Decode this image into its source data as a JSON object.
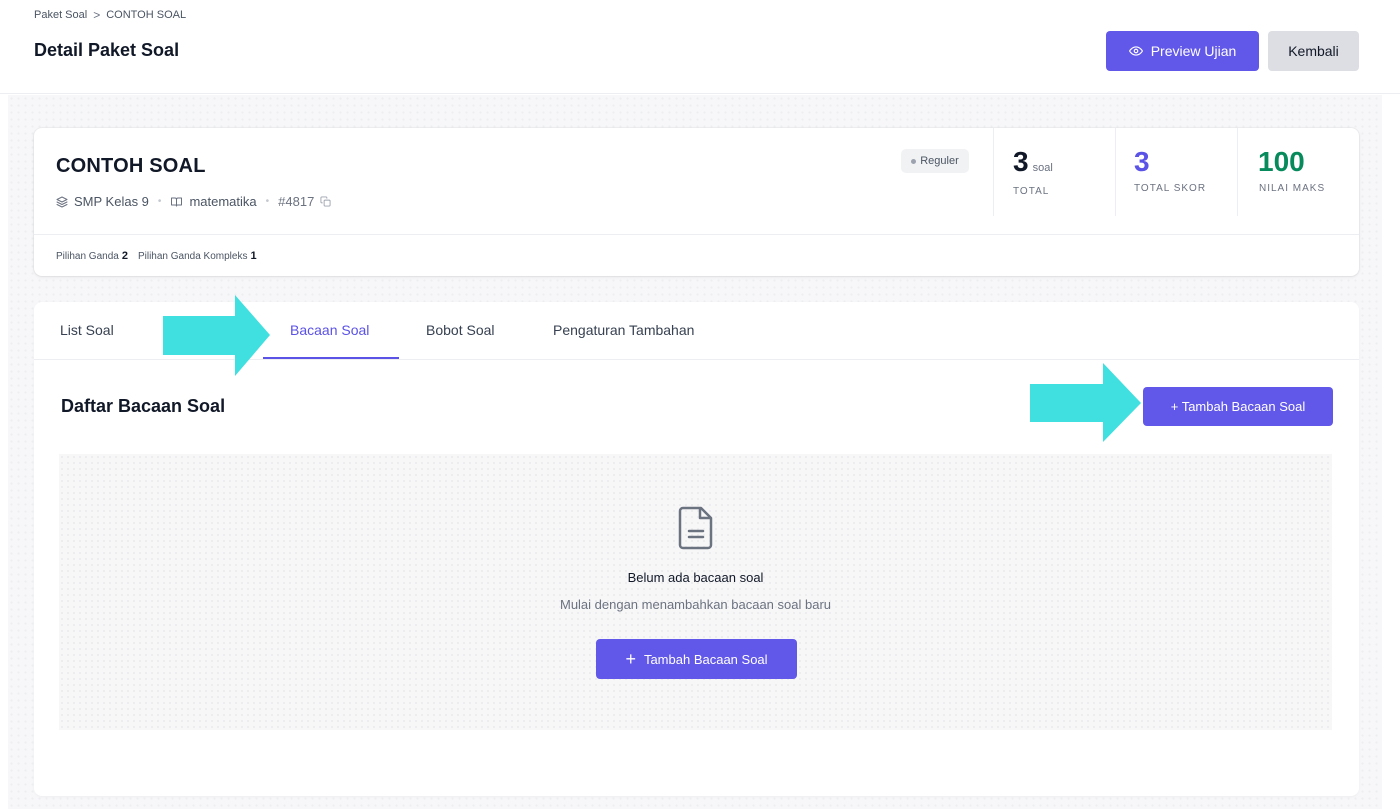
{
  "breadcrumb": {
    "root": "Paket Soal",
    "separator": ">",
    "current": "CONTOH SOAL"
  },
  "header": {
    "title": "Detail Paket Soal",
    "preview_label": "Preview Ujian",
    "back_label": "Kembali"
  },
  "summary": {
    "name": "CONTOH SOAL",
    "level": "SMP Kelas 9",
    "subject": "matematika",
    "id": "#4817",
    "badge": "Reguler",
    "stats": [
      {
        "value": "3",
        "unit": "soal",
        "label": "TOTAL",
        "color": "#111827"
      },
      {
        "value": "3",
        "unit": "",
        "label": "TOTAL SKOR",
        "color": "#5b52e6"
      },
      {
        "value": "100",
        "unit": "",
        "label": "NILAI MAKS",
        "color": "#078a5c"
      }
    ],
    "question_types": [
      {
        "label": "Pilihan Ganda",
        "count": "2"
      },
      {
        "label": "Pilihan Ganda Kompleks",
        "count": "1"
      }
    ]
  },
  "tabs": [
    {
      "label": "List Soal",
      "active": false
    },
    {
      "label": "Bacaan Soal",
      "active": true
    },
    {
      "label": "Bobot Soal",
      "active": false
    },
    {
      "label": "Pengaturan Tambahan",
      "active": false
    }
  ],
  "section": {
    "title": "Daftar Bacaan Soal",
    "add_button": "+ Tambah Bacaan Soal",
    "empty_title": "Belum ada bacaan soal",
    "empty_desc": "Mulai dengan menambahkan bacaan soal baru",
    "empty_add_button": "Tambah Bacaan Soal"
  },
  "colors": {
    "primary": "#6157e8",
    "annotation_arrow": "#40dfe0",
    "success": "#078a5c"
  }
}
